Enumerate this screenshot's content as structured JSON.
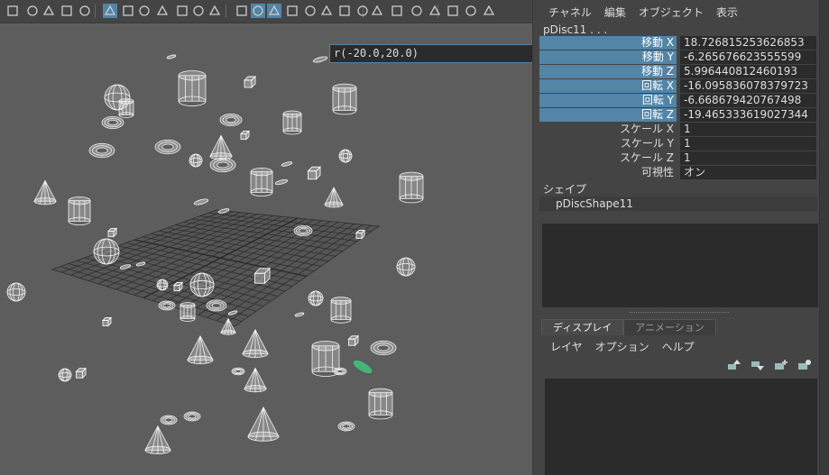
{
  "viewport": {
    "toolbar_icons": [
      "camera-icon",
      "bookmark-icon",
      "film-icon",
      "move-icon",
      "brush-icon",
      "grid-icon",
      "resolution-gate-icon",
      "gate-mask-icon",
      "field-chart-icon",
      "safe-area-icon",
      "film-gate-icon",
      "text-icon",
      "wireframe-icon",
      "shaded-icon",
      "wireframe-on-shaded-icon",
      "texture-icon",
      "lights-icon",
      "shadows-icon",
      "screen-ao-icon",
      "motion-blur-icon",
      "anti-alias-icon",
      "depth-of-field-icon",
      "isolate-icon",
      "xray-icon",
      "xray-joints-icon",
      "xray-active-icon",
      "backface-icon"
    ],
    "coord_readout": "r(-20.0,20.0)"
  },
  "channel_box": {
    "menu": [
      "チャネル",
      "編集",
      "オブジェクト",
      "表示"
    ],
    "node_name": "pDisc11 . . .",
    "attributes": [
      {
        "label": "移動 X",
        "value": "18.726815253626853",
        "highlighted": true
      },
      {
        "label": "移動 Y",
        "value": "-6.265676623555599",
        "highlighted": true
      },
      {
        "label": "移動 Z",
        "value": "5.996440812460193",
        "highlighted": true
      },
      {
        "label": "回転 X",
        "value": "-16.095836078379723",
        "highlighted": true
      },
      {
        "label": "回転 Y",
        "value": "-6.668679420767498",
        "highlighted": true
      },
      {
        "label": "回転 Z",
        "value": "-19.465333619027344",
        "highlighted": true
      },
      {
        "label": "スケール X",
        "value": "1",
        "highlighted": false
      },
      {
        "label": "スケール Y",
        "value": "1",
        "highlighted": false
      },
      {
        "label": "スケール Z",
        "value": "1",
        "highlighted": false
      },
      {
        "label": "可視性",
        "value": "オン",
        "highlighted": false
      }
    ],
    "shapes_title": "シェイプ",
    "shape_name": "pDiscShape11"
  },
  "layer_editor": {
    "tabs": [
      {
        "label": "ディスプレイ",
        "active": true
      },
      {
        "label": "アニメーション",
        "active": false
      }
    ],
    "menu": [
      "レイヤ",
      "オプション",
      "ヘルプ"
    ],
    "icons": [
      "move-layer-up-icon",
      "move-layer-down-icon",
      "new-layer-icon",
      "new-layer-selected-icon"
    ]
  },
  "colors": {
    "highlight": "#5285a6",
    "field_bg": "#2b2b2b",
    "viewport_bg": "#5d5d5d",
    "selected_object": "#3ec47a"
  }
}
